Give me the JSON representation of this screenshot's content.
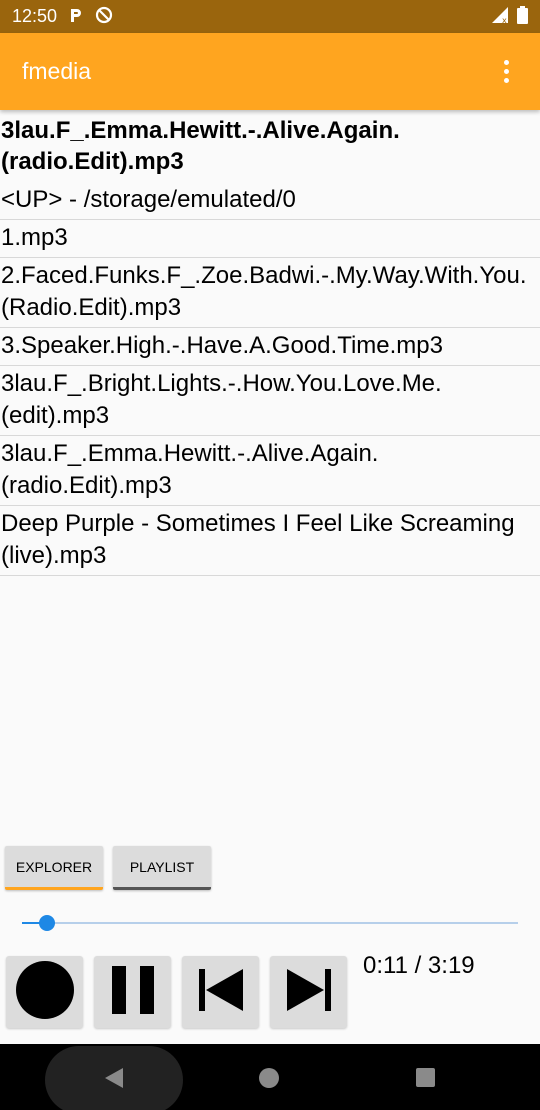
{
  "status_bar": {
    "time": "12:50",
    "icons_left": [
      "signal-p-icon",
      "do-not-disturb-icon"
    ],
    "icons_right": [
      "cell-signal-icon",
      "battery-icon"
    ]
  },
  "app_bar": {
    "title": "fmedia",
    "menu_icon": "overflow-menu-icon"
  },
  "current_track": "3lau.F_.Emma.Hewitt.-.Alive.Again.(radio.Edit).mp3",
  "files": [
    "<UP> - /storage/emulated/0",
    "1.mp3",
    "2.Faced.Funks.F_.Zoe.Badwi.-.My.Way.With.You.(Radio.Edit).mp3",
    "3.Speaker.High.-.Have.A.Good.Time.mp3",
    "3lau.F_.Bright.Lights.-.How.You.Love.Me.(edit).mp3",
    "3lau.F_.Emma.Hewitt.-.Alive.Again.(radio.Edit).mp3",
    "Deep Purple - Sometimes I Feel Like Screaming (live).mp3"
  ],
  "tabs": {
    "explorer": "EXPLORER",
    "playlist": "PLAYLIST"
  },
  "playback": {
    "progress": 0.05,
    "time_text": "0:11 / 3:19"
  },
  "controls": [
    "record-icon",
    "pause-icon",
    "skip-previous-icon",
    "skip-next-icon"
  ],
  "colors": {
    "status_bar": "#9a650d",
    "app_bar": "#ffa51f",
    "seek_accent": "#1e88e5"
  }
}
